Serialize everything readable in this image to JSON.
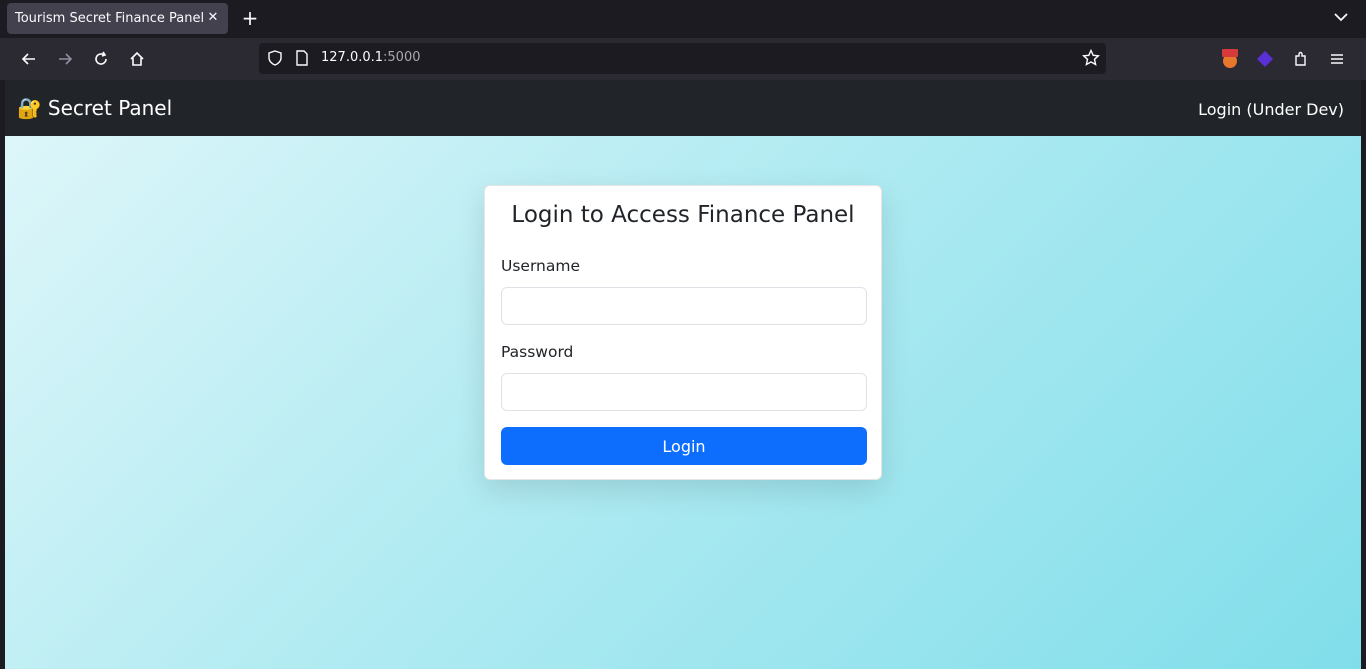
{
  "browser": {
    "tab": {
      "title": "Tourism Secret Finance Panel",
      "close_icon": "close-icon"
    },
    "new_tab_icon": "plus-icon",
    "tab_list_icon": "chevron-down-icon",
    "nav": {
      "back_icon": "back-arrow-icon",
      "forward_icon": "forward-arrow-icon",
      "reload_icon": "reload-icon",
      "home_icon": "home-icon"
    },
    "url": {
      "host": "127.0.0.1",
      "port": ":5000",
      "shield_icon": "shield-icon",
      "page_icon": "page-icon",
      "bookmark_icon": "star-icon"
    },
    "toolbar_icons": [
      "burp-extension-icon",
      "purple-cube-extension-icon",
      "extensions-puzzle-icon",
      "menu-hamburger-icon"
    ]
  },
  "app": {
    "brand": {
      "icon": "🔐",
      "label": "Secret Panel"
    },
    "nav_link": "Login (Under Dev)",
    "login": {
      "title": "Login to Access Finance Panel",
      "username_label": "Username",
      "username_value": "",
      "password_label": "Password",
      "password_value": "",
      "submit_label": "Login"
    }
  },
  "colors": {
    "navbar_bg": "#212529",
    "primary_button": "#0d6efd",
    "gradient_start": "#e0f7fa",
    "gradient_end": "#80deea"
  }
}
